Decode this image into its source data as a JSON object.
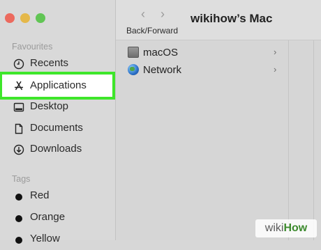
{
  "window": {
    "title": "wikihow’s Mac",
    "nav_caption": "Back/Forward",
    "back_glyph": "‹",
    "forward_glyph": "›"
  },
  "sidebar": {
    "favourites_header": "Favourites",
    "favourites": [
      {
        "label": "Recents",
        "icon": "clock-icon"
      },
      {
        "label": "Applications",
        "icon": "applications-icon",
        "selected": true
      },
      {
        "label": "Desktop",
        "icon": "desktop-icon"
      },
      {
        "label": "Documents",
        "icon": "document-icon"
      },
      {
        "label": "Downloads",
        "icon": "download-icon"
      }
    ],
    "tags_header": "Tags",
    "tags": [
      {
        "label": "Red",
        "color": "#111111"
      },
      {
        "label": "Orange",
        "color": "#111111"
      },
      {
        "label": "Yellow",
        "color": "#111111"
      }
    ]
  },
  "main": {
    "items": [
      {
        "label": "macOS",
        "icon": "hard-disk-icon",
        "chevron": "›"
      },
      {
        "label": "Network",
        "icon": "globe-icon",
        "chevron": "›"
      }
    ]
  },
  "watermark": {
    "part1": "wiki",
    "part2": "How"
  },
  "colors": {
    "highlight": "#3ee62a",
    "close": "#ec6a5e",
    "minimize": "#e5b84a",
    "maximize": "#61c554"
  }
}
